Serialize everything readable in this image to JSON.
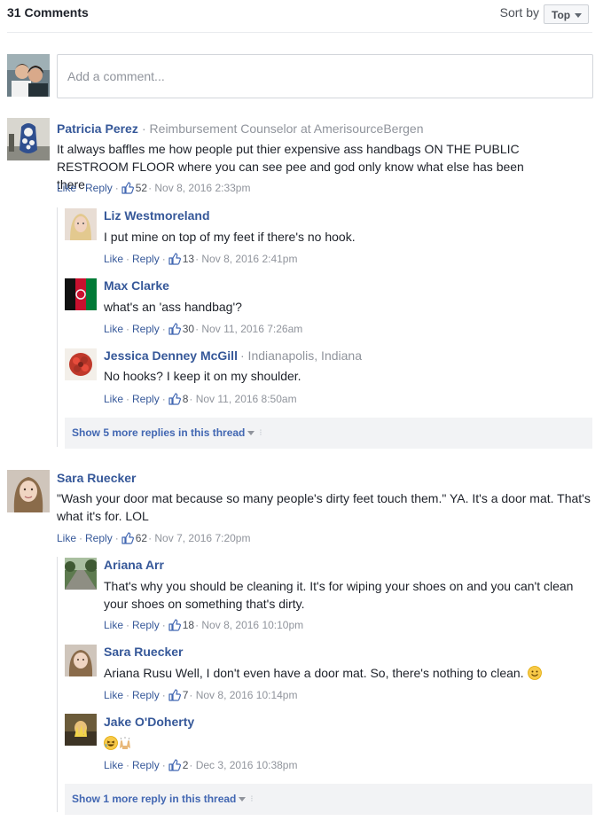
{
  "header": {
    "count_label": "31 Comments",
    "sort_label": "Sort by",
    "sort_value": "Top"
  },
  "composer": {
    "placeholder": "Add a comment..."
  },
  "actions": {
    "like": "Like",
    "reply": "Reply",
    "sep": "·"
  },
  "comments": [
    {
      "name": "Patricia Perez",
      "meta": "· Reimbursement Counselor at AmerisourceBergen",
      "text": "It always baffles me how people put thier expensive ass handbags ON THE PUBLIC RESTROOM FLOOR where you can see pee and god only know what else has been there.",
      "likes": "52",
      "time": "· Nov 8, 2016 2:33pm",
      "replies": [
        {
          "name": "Liz Westmoreland",
          "text": "I put mine on top of my feet if there's no hook.",
          "likes": "13",
          "time": "· Nov 8, 2016 2:41pm"
        },
        {
          "name": "Max Clarke",
          "text": "what's an 'ass handbag'?",
          "likes": "30",
          "time": "· Nov 11, 2016 7:26am"
        },
        {
          "name": "Jessica Denney McGill",
          "meta": "· Indianapolis, Indiana",
          "text": "No hooks? I keep it on my shoulder.",
          "likes": "8",
          "time": "· Nov 11, 2016 8:50am"
        }
      ],
      "more_replies": "Show 5 more replies in this thread"
    },
    {
      "name": "Sara Ruecker",
      "text": "\"Wash your door mat because so many people's dirty feet touch them.\" YA. It's a door mat. That's what it's for. LOL",
      "likes": "62",
      "time": "· Nov 7, 2016 7:20pm",
      "replies": [
        {
          "name": "Ariana Arr",
          "text": "That's why you should be cleaning it. It's for wiping your shoes on and you can't clean your shoes on something that's dirty.",
          "likes": "18",
          "time": "· Nov 8, 2016 10:10pm"
        },
        {
          "name": "Sara Ruecker",
          "text": "Ariana Rusu Well, I don't even have a door mat. So, there's nothing to clean.",
          "likes": "7",
          "time": "· Nov 8, 2016 10:14pm"
        },
        {
          "name": "Jake O'Doherty",
          "likes": "2",
          "time": "· Dec 3, 2016 10:38pm"
        }
      ],
      "more_replies": "Show 1 more reply in this thread"
    }
  ],
  "colors": {
    "link": "#365899",
    "meta": "#90949c",
    "text": "#1d2129",
    "divider": "#e9ebee",
    "more_bg": "#f2f3f5"
  },
  "icons": {
    "like": "thumbs-up-icon",
    "sort": "chevron-down-icon",
    "smile": "smiley-emoji-icon"
  }
}
